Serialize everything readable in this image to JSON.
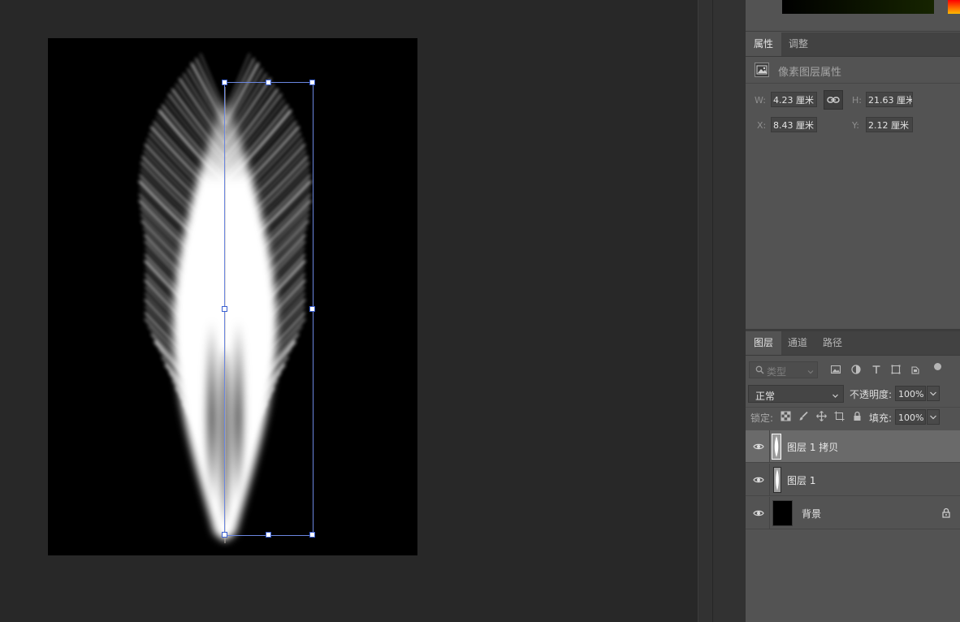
{
  "properties_panel": {
    "tabs": [
      {
        "label": "属性",
        "active": true
      },
      {
        "label": "调整",
        "active": false
      }
    ],
    "header_title": "像素图层属性",
    "header_icon": "image-icon",
    "w_label": "W:",
    "w_value": "4.23 厘米",
    "h_label": "H:",
    "h_value": "21.63 厘米",
    "x_label": "X:",
    "x_value": "8.43 厘米",
    "y_label": "Y:",
    "y_value": "2.12 厘米",
    "link_icon": "link-icon"
  },
  "layers_panel": {
    "tabs": [
      {
        "label": "图层",
        "active": true
      },
      {
        "label": "通道",
        "active": false
      },
      {
        "label": "路径",
        "active": false
      }
    ],
    "filter_placeholder": "类型",
    "filter_icons": [
      "image-filter-icon",
      "adjustment-filter-icon",
      "type-filter-icon",
      "shape-filter-icon",
      "smart-object-filter-icon",
      "filter-toggle-icon"
    ],
    "blend_mode": "正常",
    "opacity_label": "不透明度:",
    "opacity_value": "100%",
    "lock_label": "锁定:",
    "lock_icons": [
      "lock-transparent-icon",
      "lock-image-icon",
      "lock-position-icon",
      "lock-artboard-icon",
      "lock-all-icon"
    ],
    "fill_label": "填充:",
    "fill_value": "100%",
    "layers": [
      {
        "name": "图层 1 拷贝",
        "visible": true,
        "selected": true,
        "locked": false
      },
      {
        "name": "图层 1",
        "visible": true,
        "selected": false,
        "locked": false
      },
      {
        "name": "背景",
        "visible": true,
        "selected": false,
        "locked": true
      }
    ]
  },
  "colors": {
    "workspace": "#282828",
    "panel": "#535353",
    "selected_layer": "#6a6a6a",
    "transform_handle": "#6b87e0"
  }
}
